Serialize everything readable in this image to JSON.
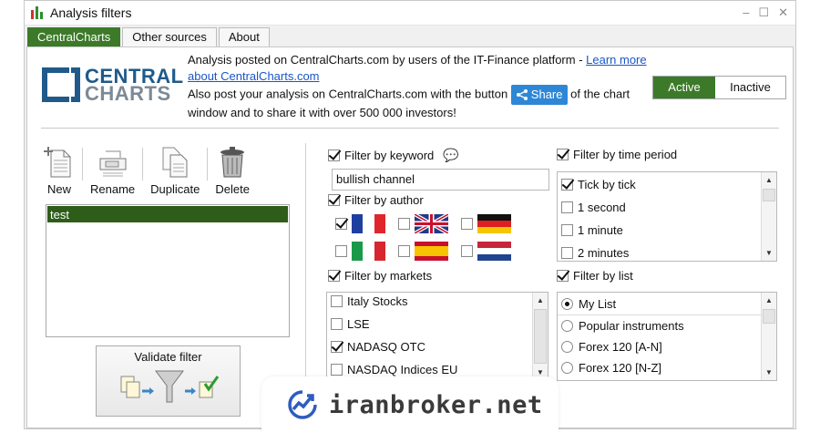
{
  "window": {
    "title": "Analysis filters",
    "controls": [
      "–",
      "☐",
      "✕"
    ]
  },
  "tabs": [
    {
      "label": "CentralCharts",
      "active": true
    },
    {
      "label": "Other sources",
      "active": false
    },
    {
      "label": "About",
      "active": false
    }
  ],
  "logo": {
    "line1": "CENTRAL",
    "line2": "CHARTS"
  },
  "info": {
    "line1": "Analysis posted on CentralCharts.com by users of the IT-Finance platform - ",
    "link": "Learn more about CentralCharts.com",
    "line2a": "Also post your analysis on CentralCharts.com with the button",
    "share_label": "Share",
    "line2b": "of the chart window and to share it with over 500 000 investors!"
  },
  "status_toggle": {
    "active_label": "Active",
    "inactive_label": "Inactive",
    "selected": "Active"
  },
  "toolbar": {
    "new_label": "New",
    "rename_label": "Rename",
    "duplicate_label": "Duplicate",
    "delete_label": "Delete"
  },
  "filter_list": {
    "items": [
      "test"
    ],
    "selected": "test"
  },
  "validate_label": "Validate filter",
  "keyword_filter": {
    "label": "Filter by keyword",
    "checked": true,
    "value": "bullish channel"
  },
  "author_filter": {
    "label": "Filter by author",
    "checked": true,
    "flags": [
      {
        "name": "france",
        "checked": true
      },
      {
        "name": "united-kingdom",
        "checked": false
      },
      {
        "name": "germany",
        "checked": false
      },
      {
        "name": "italy",
        "checked": false
      },
      {
        "name": "spain",
        "checked": false
      },
      {
        "name": "netherlands",
        "checked": false
      }
    ]
  },
  "time_filter": {
    "label": "Filter by time period",
    "checked": true,
    "options": [
      {
        "label": "Tick by tick",
        "checked": true
      },
      {
        "label": "1 second",
        "checked": false
      },
      {
        "label": "1 minute",
        "checked": false
      },
      {
        "label": "2 minutes",
        "checked": false
      }
    ]
  },
  "markets_filter": {
    "label": "Filter by markets",
    "checked": true,
    "options": [
      {
        "label": "Italy Stocks",
        "checked": false
      },
      {
        "label": "LSE",
        "checked": false
      },
      {
        "label": "NADASQ OTC",
        "checked": true
      },
      {
        "label": "NASDAQ Indices EU",
        "checked": false
      }
    ]
  },
  "list_filter": {
    "label": "Filter by list",
    "checked": true,
    "options": [
      {
        "label": "My List",
        "selected": true
      },
      {
        "label": "Popular instruments",
        "selected": false
      },
      {
        "label": "Forex 120 [A-N]",
        "selected": false
      },
      {
        "label": "Forex 120 [N-Z]",
        "selected": false
      }
    ]
  },
  "watermark": {
    "text": "iranbroker.net"
  },
  "colors": {
    "accent_green": "#3c7a29",
    "share_blue": "#2e87d6",
    "logo_blue": "#1f5a8a"
  }
}
